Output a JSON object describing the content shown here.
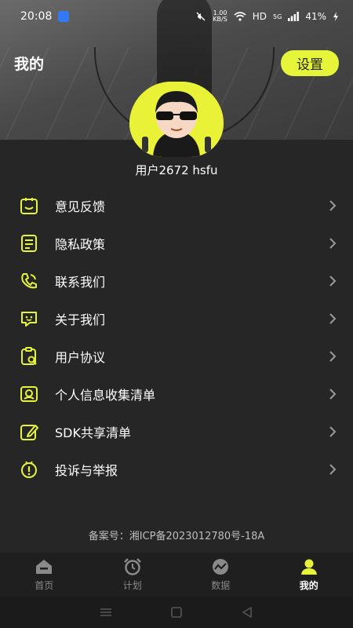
{
  "status_bar": {
    "time": "20:08",
    "net_speed_value": "1.00",
    "net_speed_unit": "KB/S",
    "hd": "HD",
    "signal": "5G",
    "battery": "41%"
  },
  "header": {
    "title": "我的",
    "settings_label": "设置"
  },
  "user": {
    "name": "用户2672  hsfu"
  },
  "menu": [
    {
      "label": "意见反馈",
      "icon": "feedback-icon"
    },
    {
      "label": "隐私政策",
      "icon": "privacy-doc-icon"
    },
    {
      "label": "联系我们",
      "icon": "phone-icon"
    },
    {
      "label": "关于我们",
      "icon": "chat-bubble-icon"
    },
    {
      "label": "用户协议",
      "icon": "agreement-icon"
    },
    {
      "label": "个人信息收集清单",
      "icon": "personal-info-icon"
    },
    {
      "label": "SDK共享清单",
      "icon": "sdk-edit-icon"
    },
    {
      "label": "投诉与举报",
      "icon": "report-icon"
    }
  ],
  "footer": {
    "icp": "备案号：湘ICP备2023012780号-18A"
  },
  "tabs": [
    {
      "label": "首页",
      "icon": "home-icon",
      "active": false
    },
    {
      "label": "计划",
      "icon": "alarm-clock-icon",
      "active": false
    },
    {
      "label": "数据",
      "icon": "chart-icon",
      "active": false
    },
    {
      "label": "我的",
      "icon": "person-icon",
      "active": true
    }
  ],
  "colors": {
    "accent": "#e6f53a",
    "background": "#262626",
    "tab_bar": "#1f1f1f"
  }
}
